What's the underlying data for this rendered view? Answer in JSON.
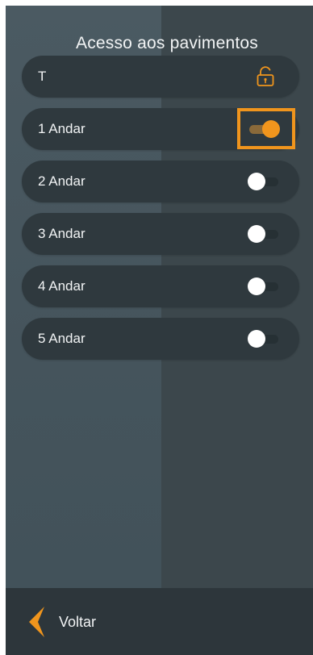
{
  "header": {
    "title": "Acesso aos pavimentos"
  },
  "floors": [
    {
      "label": "T",
      "control": "lock-icon",
      "locked": false
    },
    {
      "label": "1 Andar",
      "control": "toggle",
      "on": true,
      "highlighted": true
    },
    {
      "label": "2 Andar",
      "control": "toggle",
      "on": false
    },
    {
      "label": "3 Andar",
      "control": "toggle",
      "on": false
    },
    {
      "label": "4 Andar",
      "control": "toggle",
      "on": false
    },
    {
      "label": "5 Andar",
      "control": "toggle",
      "on": false
    }
  ],
  "footer": {
    "back_label": "Voltar",
    "back_icon": "chevron-left-icon"
  },
  "colors": {
    "accent": "#f0951d",
    "row_bg": "#2f393e",
    "bg_left": "#4b5a62",
    "bg_right": "#3c474c",
    "footer_bg": "#2d363b",
    "text": "#f2f4f5",
    "toggle_off_knob": "#ffffff"
  }
}
